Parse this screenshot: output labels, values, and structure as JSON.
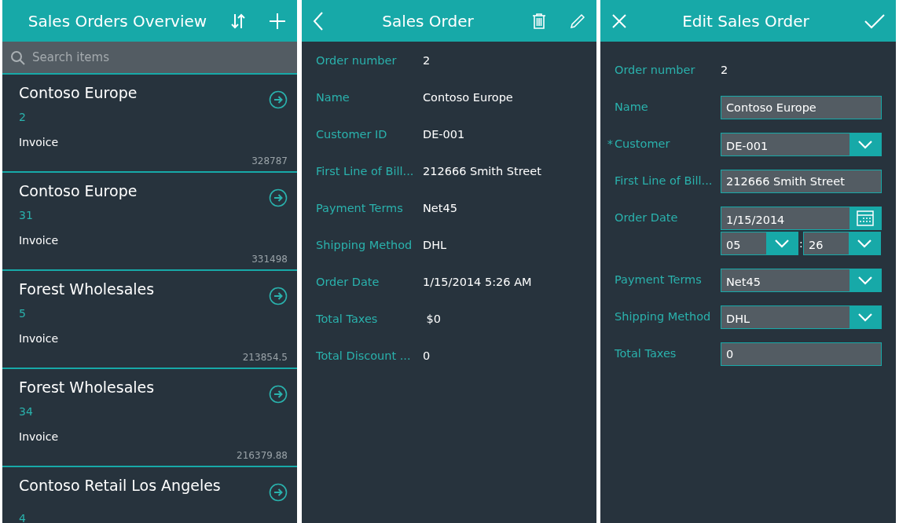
{
  "list_screen": {
    "title": "Sales Orders Overview",
    "search": {
      "placeholder": "Search items"
    },
    "items": [
      {
        "name": "Contoso Europe",
        "number": "2",
        "type": "Invoice",
        "amount": "328787"
      },
      {
        "name": "Contoso Europe",
        "number": "31",
        "type": "Invoice",
        "amount": "331498"
      },
      {
        "name": "Forest Wholesales",
        "number": "5",
        "type": "Invoice",
        "amount": "213854.5"
      },
      {
        "name": "Forest Wholesales",
        "number": "34",
        "type": "Invoice",
        "amount": "216379.88"
      },
      {
        "name": "Contoso Retail Los Angeles",
        "number": "4"
      }
    ]
  },
  "detail_screen": {
    "title": "Sales Order",
    "fields": [
      {
        "label": "Order number",
        "value": "2"
      },
      {
        "label": "Name",
        "value": "Contoso Europe"
      },
      {
        "label": "Customer ID",
        "value": "DE-001"
      },
      {
        "label": "First Line of Bill...",
        "value": "212666 Smith Street"
      },
      {
        "label": "Payment Terms",
        "value": "Net45"
      },
      {
        "label": "Shipping Method",
        "value": "DHL"
      },
      {
        "label": "Order Date",
        "value": "1/15/2014 5:26 AM"
      },
      {
        "label": "Total Taxes",
        "value": " $0"
      },
      {
        "label": "Total Discount ...",
        "value": "0"
      }
    ]
  },
  "edit_screen": {
    "title": "Edit Sales Order",
    "fields": [
      {
        "kind": "readonly",
        "label": "Order number",
        "value": "2"
      },
      {
        "kind": "text",
        "label": "Name",
        "value": "Contoso Europe"
      },
      {
        "kind": "dropdown",
        "label": "Customer",
        "marker": "*",
        "value": "DE-001"
      },
      {
        "kind": "text",
        "label": "First Line of Bill...",
        "value": "212666 Smith Street"
      },
      {
        "kind": "datetime",
        "label": "Order Date",
        "value": "1/15/2014",
        "hour": "05",
        "separator": ":",
        "minute": "26"
      },
      {
        "kind": "dropdown",
        "label": "Payment Terms",
        "value": "Net45"
      },
      {
        "kind": "dropdown",
        "label": "Shipping Method",
        "value": "DHL"
      },
      {
        "kind": "text",
        "label": "Total Taxes",
        "value": "0"
      }
    ]
  }
}
